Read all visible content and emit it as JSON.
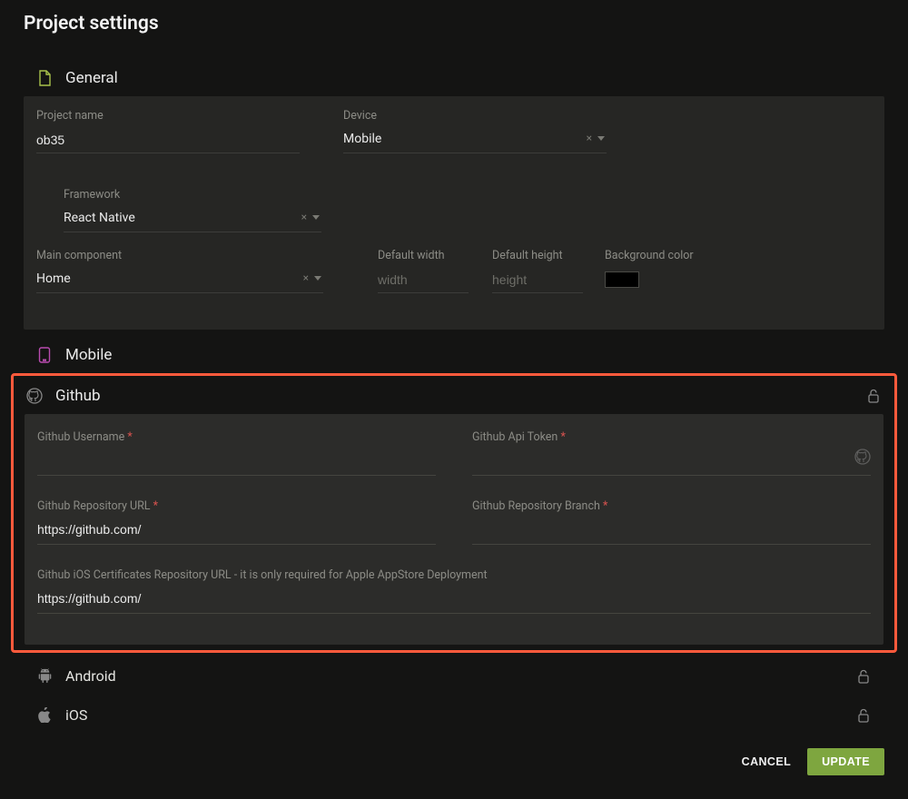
{
  "page": {
    "title": "Project settings"
  },
  "sections": {
    "general": {
      "title": "General"
    },
    "mobile": {
      "title": "Mobile"
    },
    "github": {
      "title": "Github"
    },
    "android": {
      "title": "Android"
    },
    "ios": {
      "title": "iOS"
    }
  },
  "general": {
    "projectName": {
      "label": "Project name",
      "value": "ob35"
    },
    "device": {
      "label": "Device",
      "value": "Mobile"
    },
    "framework": {
      "label": "Framework",
      "value": "React Native"
    },
    "mainComponent": {
      "label": "Main component",
      "value": "Home"
    },
    "defaultWidth": {
      "label": "Default width",
      "placeholder": "width"
    },
    "defaultHeight": {
      "label": "Default height",
      "placeholder": "height"
    },
    "backgroundColor": {
      "label": "Background color",
      "value": "#000000"
    }
  },
  "github": {
    "username": {
      "label": "Github Username",
      "required": true,
      "value": ""
    },
    "apiToken": {
      "label": "Github Api Token",
      "required": true,
      "value": ""
    },
    "repoUrl": {
      "label": "Github Repository URL",
      "required": true,
      "value": "https://github.com/"
    },
    "repoBranch": {
      "label": "Github Repository Branch",
      "required": true,
      "value": ""
    },
    "iosCertRepo": {
      "label": "Github iOS Certificates Repository URL - it is only required for Apple AppStore Deployment",
      "value": "https://github.com/"
    }
  },
  "footer": {
    "cancel": "CANCEL",
    "update": "UPDATE"
  },
  "glyphs": {
    "clear": "×",
    "required": "*"
  }
}
